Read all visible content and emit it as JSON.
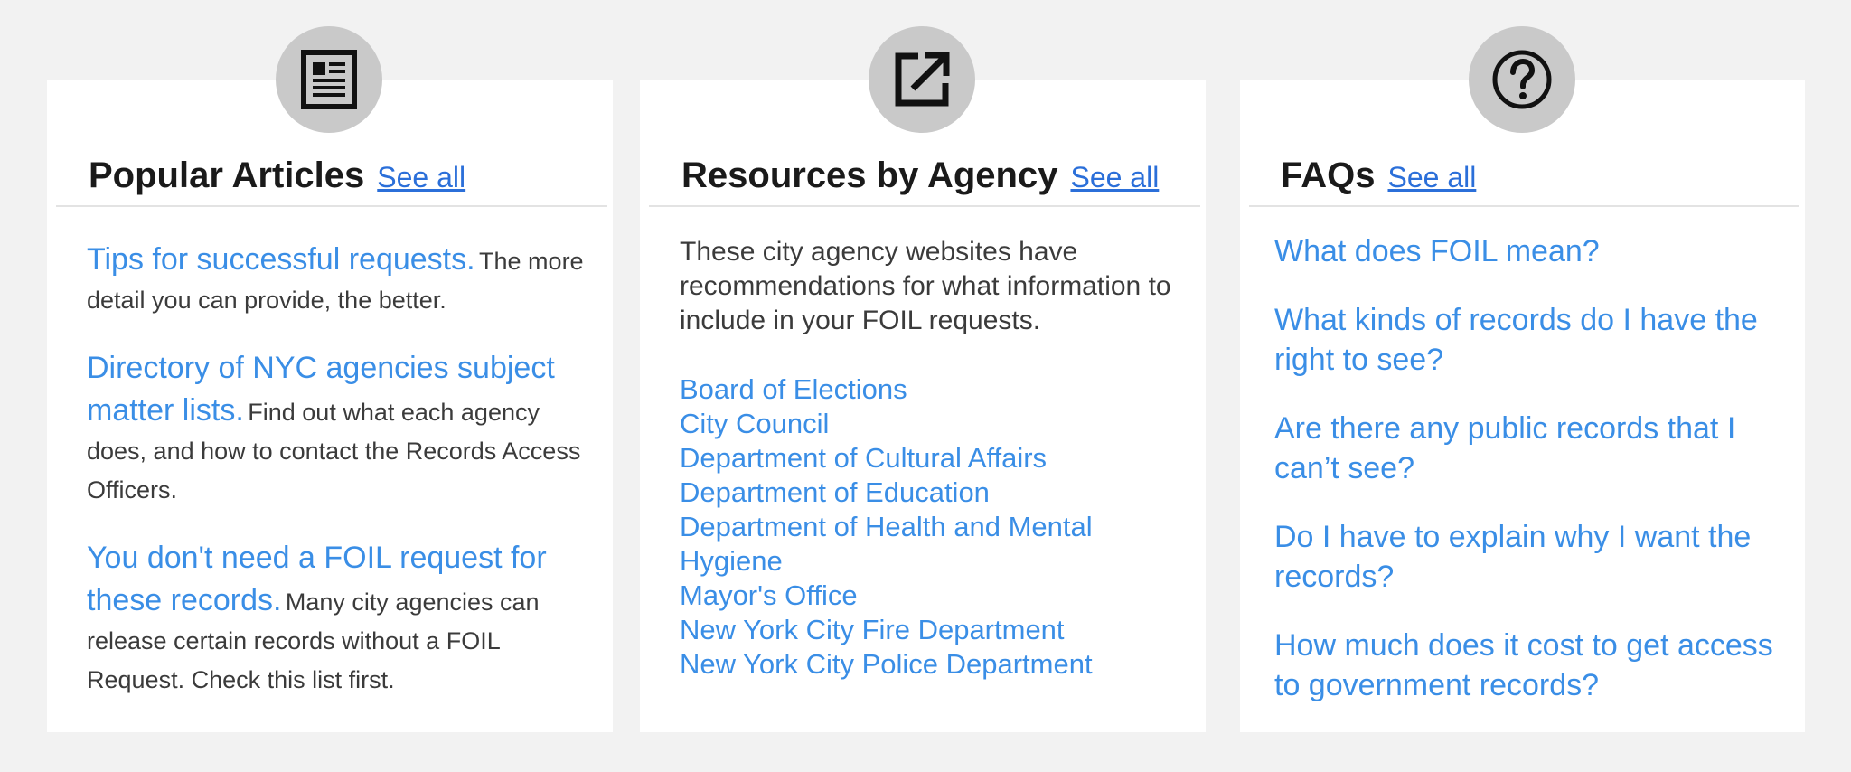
{
  "popular_articles": {
    "title": "Popular Articles",
    "see_all": "See all",
    "icon": "newspaper-icon",
    "items": [
      {
        "link": "Tips for successful requests.",
        "desc": "The more detail you can provide, the better."
      },
      {
        "link": "Directory of NYC agencies subject matter lists.",
        "desc": "Find out what each agency does, and how to contact the Records Access Officers."
      },
      {
        "link": "You don't need a FOIL request for these records.",
        "desc": "Many city agencies can release certain records without a FOIL Request. Check this list first."
      }
    ]
  },
  "resources": {
    "title": "Resources by Agency",
    "see_all": "See all",
    "icon": "external-link-icon",
    "intro": "These city agency websites have recommendations for what information to include in your FOIL requests.",
    "agencies": [
      "Board of Elections",
      "City Council",
      "Department of Cultural Affairs",
      "Department of Education",
      "Department of Health and Mental Hygiene",
      "Mayor's Office",
      "New York City Fire Department",
      "New York City Police Department"
    ]
  },
  "faqs": {
    "title": "FAQs",
    "see_all": "See all",
    "icon": "question-circle-icon",
    "items": [
      "What does FOIL mean?",
      "What kinds of records do I have the right to see?",
      "Are there any public records that I can’t see?",
      "Do I have to explain why I want the records?",
      "How much does it cost to get access to government records?"
    ]
  },
  "colors": {
    "background": "#f2f2f2",
    "card": "#ffffff",
    "link": "#3a8ee6",
    "icon_circle": "#c9c9c9"
  }
}
